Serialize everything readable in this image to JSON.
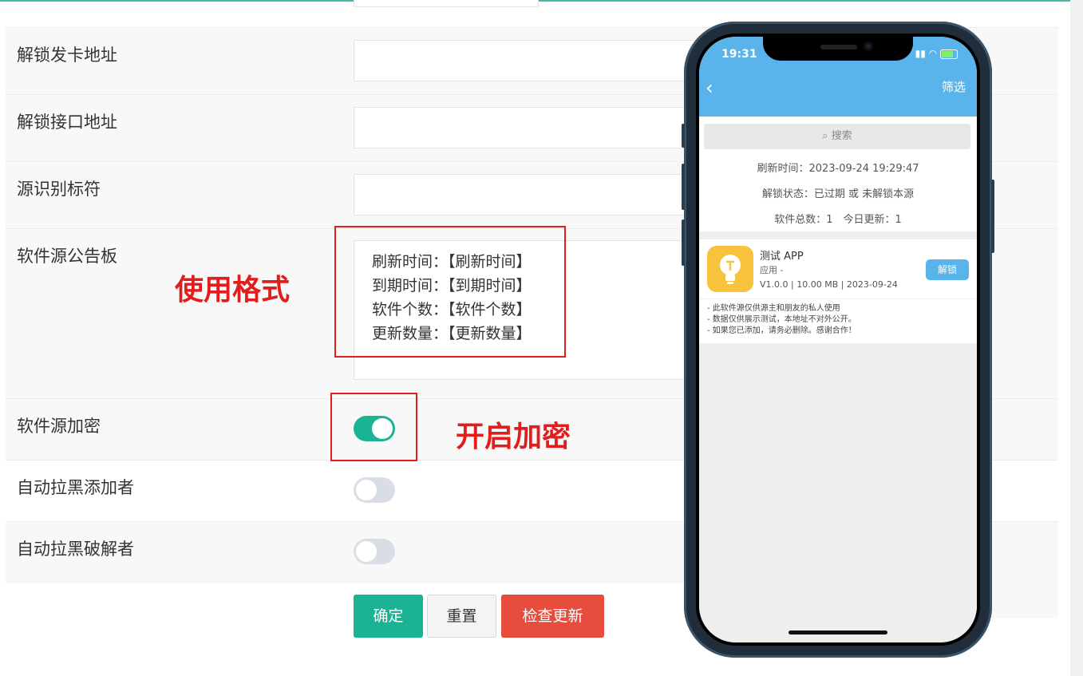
{
  "form": {
    "fields": [
      {
        "label": "解锁发卡地址",
        "value": ""
      },
      {
        "label": "解锁接口地址",
        "value": ""
      },
      {
        "label": "源识别标符",
        "value": ""
      }
    ],
    "notice": {
      "label": "软件源公告板",
      "lines": [
        "刷新时间：【刷新时间】",
        "到期时间：【到期时间】",
        "软件个数：【软件个数】",
        "更新数量：【更新数量】"
      ]
    },
    "toggles": [
      {
        "label": "软件源加密",
        "on": true
      },
      {
        "label": "自动拉黑添加者",
        "on": false
      },
      {
        "label": "自动拉黑破解者",
        "on": false
      }
    ],
    "buttons": {
      "confirm": "确定",
      "reset": "重置",
      "check_update": "检查更新"
    }
  },
  "annotations": {
    "usage_format": "使用格式",
    "enable_encrypt": "开启加密",
    "color": "#e01e1e"
  },
  "phone": {
    "time": "19:31",
    "filter": "筛选",
    "search_placeholder": "搜索",
    "refresh_time": "刷新时间：2023-09-24 19:29:47",
    "unlock_status": "解锁状态：已过期 或 未解锁本源",
    "counts": "软件总数：1　今日更新：1",
    "app": {
      "name": "测试 APP",
      "category": "应用 -",
      "meta": "V1.0.0 | 10.00 MB | 2023-09-24",
      "unlock_label": "解锁"
    },
    "notes": [
      "- 此软件源仅供源主和朋友的私人使用",
      "- 数据仅供展示测试，本地址不对外公开。",
      "- 如果您已添加，请务必删除。感谢合作！"
    ]
  },
  "colors": {
    "primary": "#1cb394",
    "danger": "#e74c3c",
    "phone_header": "#5ab4ec"
  }
}
